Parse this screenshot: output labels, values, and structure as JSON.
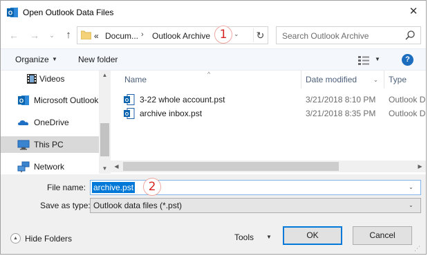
{
  "window": {
    "title": "Open Outlook Data Files",
    "close_glyph": "✕"
  },
  "nav": {
    "back": "←",
    "forward": "→",
    "recent": "⌄",
    "up": "↑",
    "refresh": "↻"
  },
  "address": {
    "overflow": "«",
    "crumbs": [
      "Docum...",
      "Outlook Archive"
    ],
    "separator": "›",
    "dropdown": "⌄"
  },
  "callouts": [
    "1",
    "2"
  ],
  "search": {
    "placeholder": "Search Outlook Archive"
  },
  "toolbar": {
    "organize": "Organize",
    "organize_dd": "▼",
    "new_folder": "New folder",
    "view_dd": "▼",
    "help": "?"
  },
  "sidebar": {
    "items": [
      {
        "label": "Videos",
        "icon": "video-folder-icon"
      },
      {
        "label": "Microsoft Outlook",
        "icon": "outlook-icon"
      },
      {
        "label": "OneDrive",
        "icon": "onedrive-icon"
      },
      {
        "label": "This PC",
        "icon": "computer-icon"
      },
      {
        "label": "Network",
        "icon": "network-icon"
      }
    ],
    "scroll_up": "▲",
    "scroll_down": "▼"
  },
  "columns": {
    "sort_caret": "^",
    "name": "Name",
    "date": "Date modified",
    "type": "Type",
    "dd": "⌄"
  },
  "files": [
    {
      "name": "3-22 whole account.pst",
      "date": "3/21/2018 8:10 PM",
      "type": "Outlook D"
    },
    {
      "name": "archive inbox.pst",
      "date": "3/21/2018 8:35 PM",
      "type": "Outlook D"
    }
  ],
  "hscroll": {
    "left": "◀",
    "right": "▶"
  },
  "bottom": {
    "filename_label": "File name:",
    "filename_value": "archive.pst",
    "filename_dd": "⌄",
    "type_label": "Save as type:",
    "type_value": "Outlook data files (*.pst)",
    "type_dd": "⌄",
    "hide_folders": "Hide Folders",
    "hide_icon": "▲",
    "tools": "Tools",
    "tools_dd": "▼",
    "ok": "OK",
    "cancel": "Cancel",
    "grip": "⋰"
  },
  "colors": {
    "accent": "#0078d7",
    "selection": "#cce8ff",
    "callout": "#d6221e",
    "outlook_blue": "#0a64ad"
  }
}
